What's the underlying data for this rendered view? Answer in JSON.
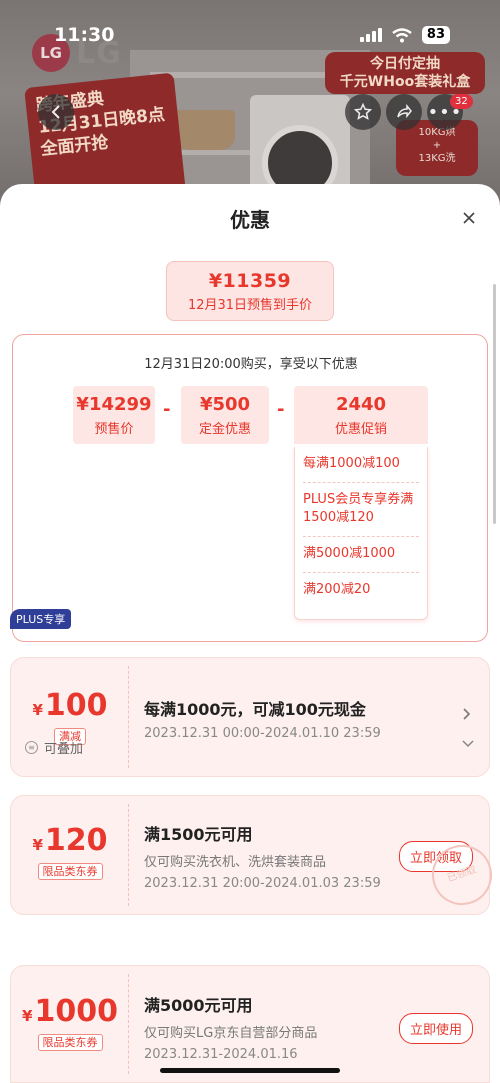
{
  "status_bar": {
    "time": "11:30",
    "battery": "83"
  },
  "background": {
    "brand": "LG",
    "promo_left": [
      "跨年盛典",
      "12月31日晚8点",
      "全面开抢"
    ],
    "promo_right": [
      "今日付定抽",
      "千元WHoo套装礼盒"
    ],
    "spec": [
      "10KG烘",
      "+",
      "13KG洗"
    ],
    "cart_count": "32"
  },
  "sheet": {
    "title": "优惠",
    "final_price": "¥11359",
    "final_label": "12月31日预售到手价",
    "calc_header": "12月31日20:00购买，享受以下优惠",
    "components": [
      {
        "value": "¥14299",
        "label": "预售价"
      },
      {
        "value": "¥500",
        "label": "定金优惠"
      },
      {
        "value": "2440",
        "label": "优惠促销"
      }
    ],
    "operator": "-",
    "promotions": [
      "每满1000减100",
      "PLUS会员专享券满1500减120",
      "满5000减1000",
      "满200减20"
    ]
  },
  "coupons": [
    {
      "currency": "¥",
      "amount": "100",
      "tag": "满减",
      "title": "每满1000元，可减100元现金",
      "desc": "",
      "period": "2023.12.31 00:00-2024.01.10 23:59",
      "action": ""
    },
    {
      "badge": "PLUS专享",
      "currency": "¥",
      "amount": "120",
      "tag": "限品类东券",
      "title": "满1500元可用",
      "desc": "仅可购买洗衣机、洗烘套装商品",
      "period": "2023.12.31 20:00-2024.01.03 23:59",
      "action": "立即领取"
    },
    {
      "currency": "¥",
      "amount": "1000",
      "tag": "限品类东券",
      "title": "满5000元可用",
      "desc": "仅可购买LG京东自营部分商品",
      "period": "2023.12.31-2024.01.16",
      "action": "立即使用"
    }
  ],
  "stackable_label": "可叠加",
  "stamp_text": "已领取"
}
